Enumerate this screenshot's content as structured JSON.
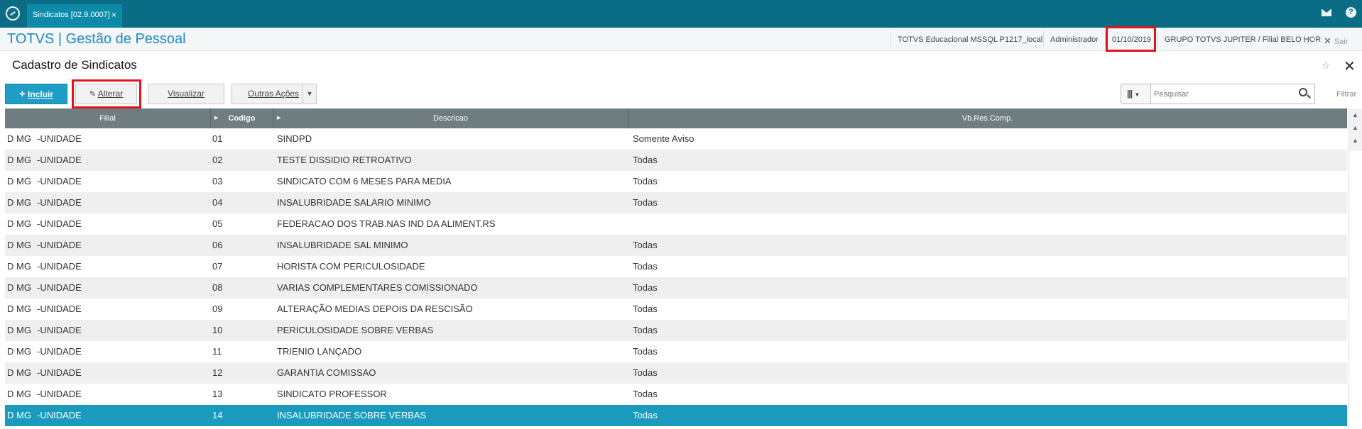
{
  "topbar": {
    "tab_label": "Sindicatos [02.9.0007]",
    "tab_close": "×"
  },
  "header": {
    "app_title": "TOTVS | Gestão de Pessoal",
    "environment": "TOTVS Educacional MSSQL P1217_local",
    "user": "Administrador",
    "date": "01/10/2019",
    "company": "GRUPO TOTVS JUPITER / Filial BELO HOR",
    "sair_label": "Sair"
  },
  "page": {
    "title": "Cadastro de Sindicatos"
  },
  "toolbar": {
    "incluir": "Incluir",
    "alterar": "Alterar",
    "visualizar": "Visualizar",
    "outras": "Outras Ações",
    "search_placeholder": "Pesquisar",
    "filtrar": "Filtrar"
  },
  "grid": {
    "columns": [
      "Filial",
      "Codigo",
      "Descricao",
      "Vb.Res.Comp."
    ],
    "rows": [
      {
        "filial": "D MG",
        "unidade": "-UNIDADE",
        "codigo": "01",
        "descricao": "SINDPD",
        "vb": "Somente Aviso"
      },
      {
        "filial": "D MG",
        "unidade": "-UNIDADE",
        "codigo": "02",
        "descricao": "TESTE DISSIDIO RETROATIVO",
        "vb": "Todas"
      },
      {
        "filial": "D MG",
        "unidade": "-UNIDADE",
        "codigo": "03",
        "descricao": "SINDICATO COM 6 MESES PARA MEDIA",
        "vb": "Todas"
      },
      {
        "filial": "D MG",
        "unidade": "-UNIDADE",
        "codigo": "04",
        "descricao": "INSALUBRIDADE SALARIO MINIMO",
        "vb": "Todas"
      },
      {
        "filial": "D MG",
        "unidade": "-UNIDADE",
        "codigo": "05",
        "descricao": "FEDERACAO DOS TRAB.NAS IND DA ALIMENT.RS",
        "vb": ""
      },
      {
        "filial": "D MG",
        "unidade": "-UNIDADE",
        "codigo": "06",
        "descricao": "INSALUBRIDADE SAL MINIMO",
        "vb": "Todas"
      },
      {
        "filial": "D MG",
        "unidade": "-UNIDADE",
        "codigo": "07",
        "descricao": "HORISTA COM PERICULOSIDADE",
        "vb": "Todas"
      },
      {
        "filial": "D MG",
        "unidade": "-UNIDADE",
        "codigo": "08",
        "descricao": "VARIAS COMPLEMENTARES COMISSIONADO",
        "vb": "Todas"
      },
      {
        "filial": "D MG",
        "unidade": "-UNIDADE",
        "codigo": "09",
        "descricao": "ALTERAÇÃO MEDIAS DEPOIS DA RESCISÃO",
        "vb": "Todas"
      },
      {
        "filial": "D MG",
        "unidade": "-UNIDADE",
        "codigo": "10",
        "descricao": "PERICULOSIDADE SOBRE VERBAS",
        "vb": "Todas"
      },
      {
        "filial": "D MG",
        "unidade": "-UNIDADE",
        "codigo": "11",
        "descricao": "TRIENIO LANÇADO",
        "vb": "Todas"
      },
      {
        "filial": "D MG",
        "unidade": "-UNIDADE",
        "codigo": "12",
        "descricao": "GARANTIA COMISSAO",
        "vb": "Todas"
      },
      {
        "filial": "D MG",
        "unidade": "-UNIDADE",
        "codigo": "13",
        "descricao": "SINDICATO PROFESSOR",
        "vb": "Todas"
      },
      {
        "filial": "D MG",
        "unidade": "-UNIDADE",
        "codigo": "14",
        "descricao": "INSALUBRIDADE SOBRE VERBAS",
        "vb": "Todas"
      }
    ],
    "selected_index": 13
  },
  "colors": {
    "topbar": "#0b6c86",
    "accent": "#1e9ec5",
    "selected_row": "#1a9bbd",
    "highlight_box": "#e1141b"
  }
}
